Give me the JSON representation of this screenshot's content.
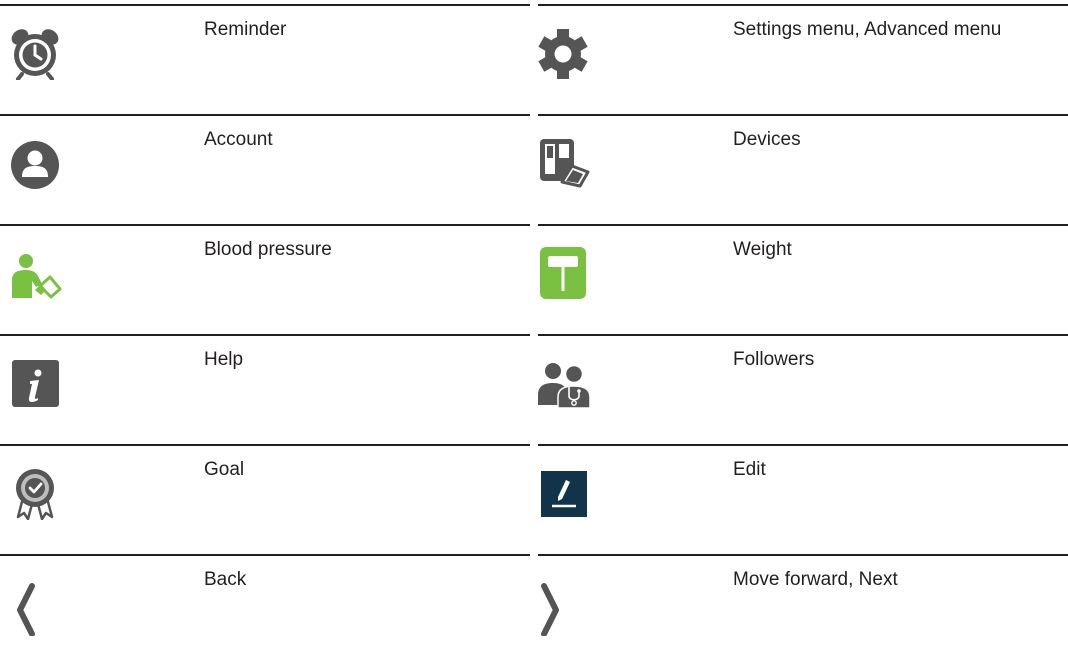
{
  "rows": [
    {
      "left": {
        "icon": "alarm-clock-icon",
        "label": "Reminder"
      },
      "right": {
        "icon": "gear-icon",
        "label": "Settings menu, Advanced menu"
      }
    },
    {
      "left": {
        "icon": "account-icon",
        "label": "Account"
      },
      "right": {
        "icon": "devices-icon",
        "label": "Devices"
      }
    },
    {
      "left": {
        "icon": "blood-pressure-icon",
        "label": "Blood pressure"
      },
      "right": {
        "icon": "weight-scale-icon",
        "label": "Weight"
      }
    },
    {
      "left": {
        "icon": "info-icon",
        "label": "Help"
      },
      "right": {
        "icon": "followers-icon",
        "label": "Followers"
      }
    },
    {
      "left": {
        "icon": "goal-badge-icon",
        "label": "Goal"
      },
      "right": {
        "icon": "edit-pencil-icon",
        "label": "Edit"
      }
    },
    {
      "left": {
        "icon": "chevron-left-icon",
        "label": "Back"
      },
      "right": {
        "icon": "chevron-right-icon",
        "label": "Move forward, Next"
      }
    }
  ],
  "colors": {
    "icon_gray": "#555555",
    "icon_green": "#7ac142",
    "edit_navy": "#12344a",
    "rule": "#231f20"
  }
}
